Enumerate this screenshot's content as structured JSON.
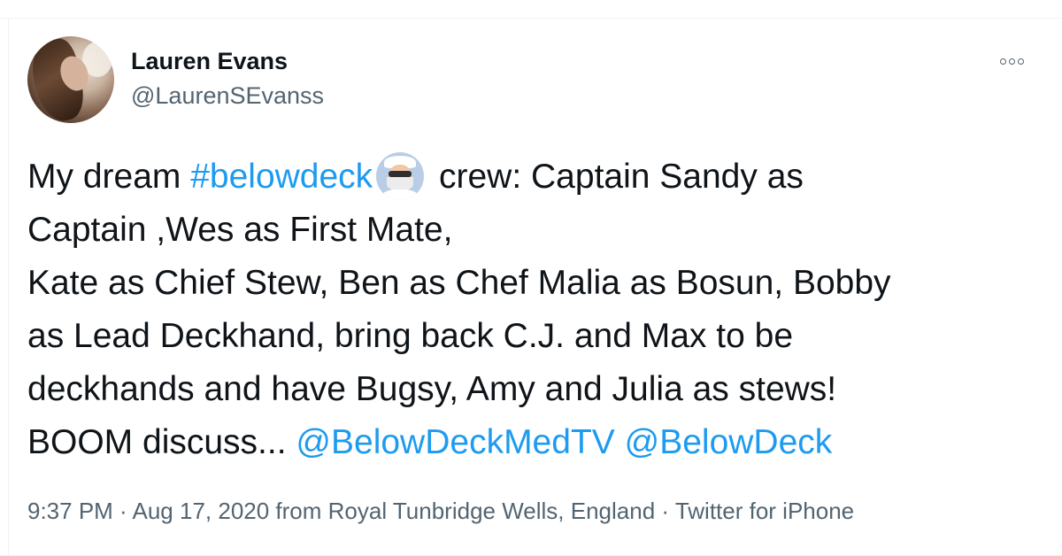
{
  "tweet": {
    "author": {
      "display_name": "Lauren Evans",
      "handle": "@LaurenSEvanss"
    },
    "more_icon": "more-horizontal-icon",
    "text_lines": [
      {
        "prefix": "My dream ",
        "hashtag": "#belowdeck",
        "emoji": "pilot-emoji",
        "suffix": " crew: Captain Sandy as"
      },
      "Captain ,Wes as First Mate,",
      "Kate as Chief Stew, Ben as Chef Malia as Bosun, Bobby",
      "as Lead Deckhand,  bring back C.J. and Max to be",
      "deckhands and have Bugsy, Amy and Julia as stews!",
      {
        "prefix": "BOOM discuss... ",
        "mention1": "@BelowDeckMedTV",
        "sep": " ",
        "mention2": "@BelowDeck"
      }
    ],
    "meta": {
      "time": "9:37 PM",
      "sep1": " · ",
      "date": "Aug 17, 2020",
      "from_text": " from ",
      "location": "Royal Tunbridge Wells, England",
      "sep2": " · ",
      "client": "Twitter for iPhone"
    }
  },
  "colors": {
    "text": "#0f1419",
    "secondary": "#536471",
    "link": "#1d9bf0",
    "border": "#eff3f4"
  }
}
